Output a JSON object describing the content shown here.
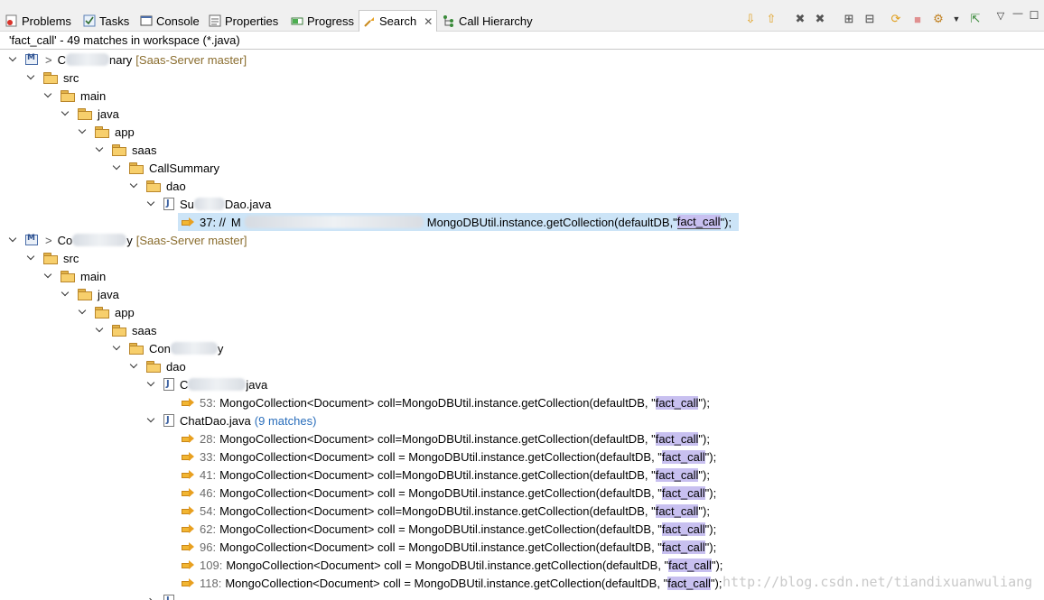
{
  "tabs": [
    {
      "label": "Problems",
      "icon": "problems-icon"
    },
    {
      "label": "Tasks",
      "icon": "tasks-icon"
    },
    {
      "label": "Console",
      "icon": "console-icon"
    },
    {
      "label": "Properties",
      "icon": "properties-icon"
    },
    {
      "label": "Progress",
      "icon": "progress-icon"
    },
    {
      "label": "Search",
      "icon": "search-icon",
      "active": true
    },
    {
      "label": "Call Hierarchy",
      "icon": "call-hierarchy-icon"
    }
  ],
  "toolbar": {
    "next_match": "⇩",
    "prev_match": "⇧",
    "remove_match": "✖",
    "remove_all": "✖",
    "expand_all": "⊞",
    "collapse_all": "⊟",
    "refresh": "⟳",
    "cancel": "■",
    "history": "⚙",
    "pin": "⇱",
    "view_menu": "▽",
    "minimize": "—",
    "maximize": "☐"
  },
  "summary": "'fact_call' - 49 matches in workspace (*.java)",
  "tree": {
    "p1": {
      "visible_start": "C",
      "visible_end": "nary",
      "repo": "[Saas-Server master]"
    },
    "p1_folders": [
      "src",
      "main",
      "java",
      "app",
      "saas",
      "CallSummary",
      "dao"
    ],
    "p1_file": {
      "visible_start": "Su",
      "visible_end": "Dao.java"
    },
    "p1_match": {
      "line": "37: //",
      "start": "M",
      "mid": "MongoDBUtil.instance.getCollection(defaultDB,\"",
      "hl": "fact_call",
      "end": "\");"
    },
    "p2": {
      "visible_start": "Co",
      "visible_end": "y",
      "repo": "[Saas-Server master]"
    },
    "p2_folders": [
      "src",
      "main",
      "java",
      "app",
      "saas",
      "Con",
      "dao"
    ],
    "p2_folder_end": "y",
    "p2_file1": {
      "visible_start": "C",
      "visible_end": "java"
    },
    "p2_file1_match": {
      "line": "53:",
      "code": "MongoCollection<Document> coll=MongoDBUtil.instance.getCollection(defaultDB, \"",
      "hl": "fact_call",
      "end": "\");"
    },
    "chat_file": {
      "name": "ChatDao.java",
      "count": "(9 matches)"
    },
    "chat_matches": [
      {
        "line": "28:",
        "code": "MongoCollection<Document> coll=MongoDBUtil.instance.getCollection(defaultDB, \"",
        "hl": "fact_call",
        "end": "\");"
      },
      {
        "line": "33:",
        "code": "MongoCollection<Document> coll = MongoDBUtil.instance.getCollection(defaultDB, \"",
        "hl": "fact_call",
        "end": "\");"
      },
      {
        "line": "41:",
        "code": "MongoCollection<Document> coll=MongoDBUtil.instance.getCollection(defaultDB, \"",
        "hl": "fact_call",
        "end": "\");"
      },
      {
        "line": "46:",
        "code": "MongoCollection<Document> coll = MongoDBUtil.instance.getCollection(defaultDB, \"",
        "hl": "fact_call",
        "end": "\");"
      },
      {
        "line": "54:",
        "code": "MongoCollection<Document> coll=MongoDBUtil.instance.getCollection(defaultDB, \"",
        "hl": "fact_call",
        "end": "\");"
      },
      {
        "line": "62:",
        "code": "MongoCollection<Document> coll = MongoDBUtil.instance.getCollection(defaultDB, \"",
        "hl": "fact_call",
        "end": "\");"
      },
      {
        "line": "96:",
        "code": "MongoCollection<Document> coll = MongoDBUtil.instance.getCollection(defaultDB, \"",
        "hl": "fact_call",
        "end": "\");"
      },
      {
        "line": "109:",
        "code": "MongoCollection<Document> coll = MongoDBUtil.instance.getCollection(defaultDB, \"",
        "hl": "fact_call",
        "end": "\");"
      },
      {
        "line": "118:",
        "code": "MongoCollection<Document> coll = MongoDBUtil.instance.getCollection(defaultDB, \"",
        "hl": "fact_call",
        "end": "\");"
      }
    ]
  },
  "watermark": "http://blog.csdn.net/tiandixuanwuliang"
}
